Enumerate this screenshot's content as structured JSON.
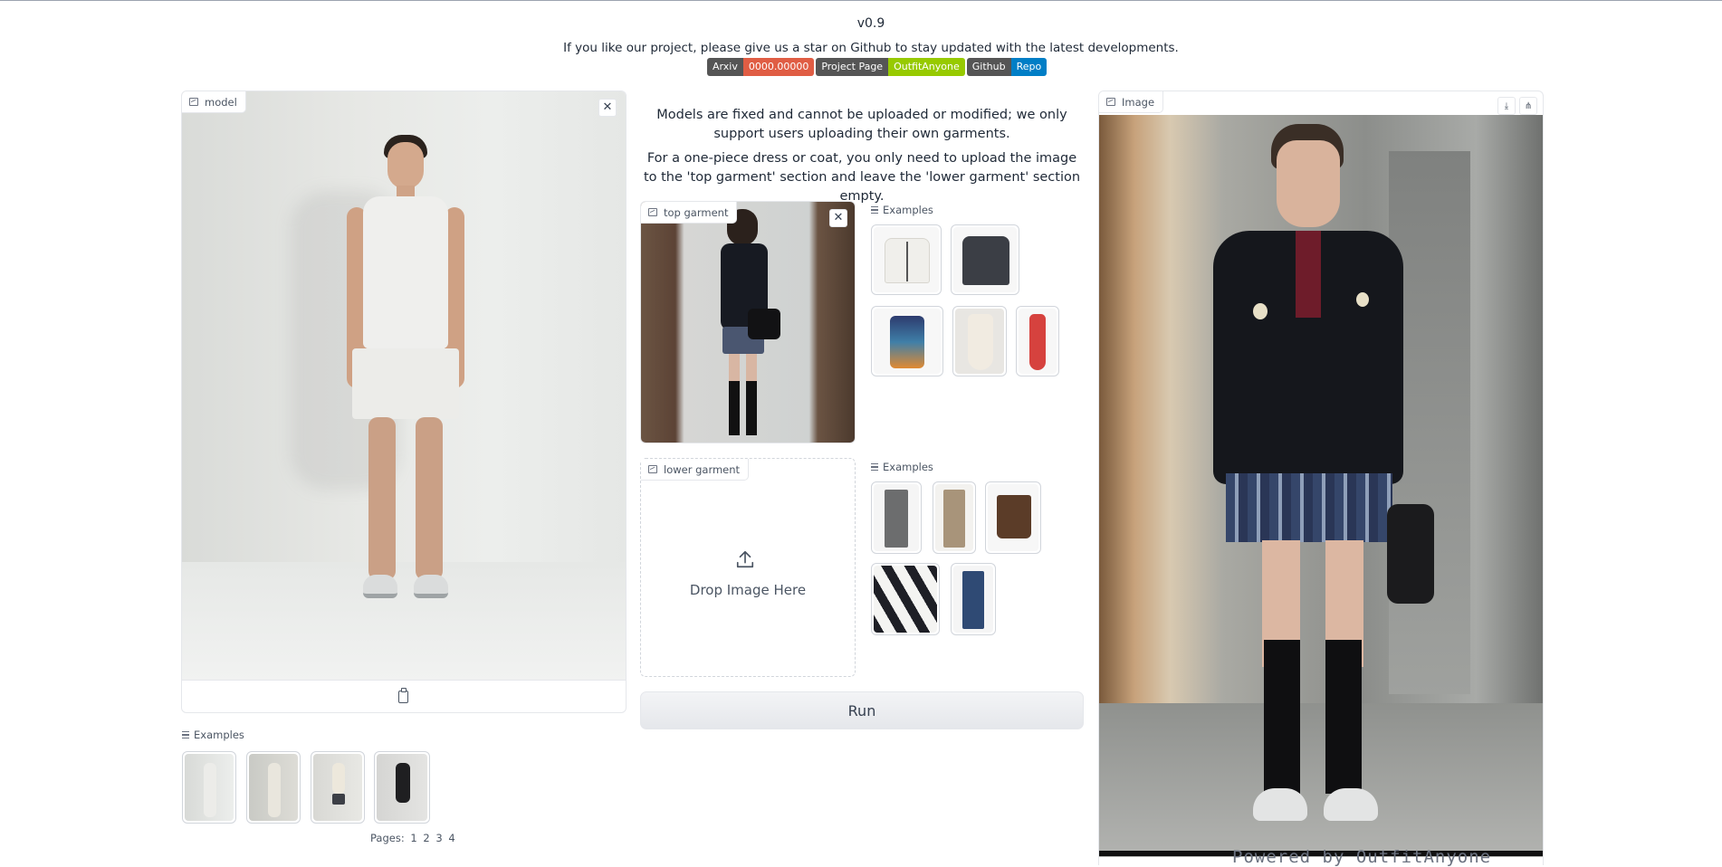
{
  "header": {
    "version": "v0.9",
    "subtitle": "If you like our project, please give us a star on Github to stay updated with the latest developments.",
    "badges": [
      {
        "left": "Arxiv",
        "right": "0000.00000",
        "right_color": "#e05d44"
      },
      {
        "left": "Project Page",
        "right": "OutfitAnyone",
        "right_color": "#97ca00"
      },
      {
        "left": "Github",
        "right": "Repo",
        "right_color": "#007ec6"
      }
    ]
  },
  "model_panel": {
    "label": "model",
    "close_icon": "close-icon",
    "paste_icon": "clipboard-icon",
    "examples_label": "Examples",
    "pages_label": "Pages:",
    "pages": [
      "1",
      "2",
      "3",
      "4"
    ]
  },
  "center": {
    "notice_1": "Models are fixed and cannot be uploaded or modified; we only support users uploading their own garments.",
    "notice_2": "For a one-piece dress or coat, you only need to upload the image to the 'top garment' section and leave the 'lower garment' section empty.",
    "top_garment": {
      "label": "top garment",
      "examples_label": "Examples"
    },
    "lower_garment": {
      "label": "lower garment",
      "drop_text": "Drop Image Here",
      "examples_label": "Examples"
    },
    "run_label": "Run"
  },
  "output_panel": {
    "label": "Image",
    "download_icon": "download-icon",
    "share_icon": "share-icon",
    "watermark": "Powered by OutfitAnyone"
  },
  "colors": {
    "accent_red": "#e05d44",
    "accent_green": "#97ca00",
    "accent_blue": "#007ec6",
    "badge_gray": "#555555"
  }
}
